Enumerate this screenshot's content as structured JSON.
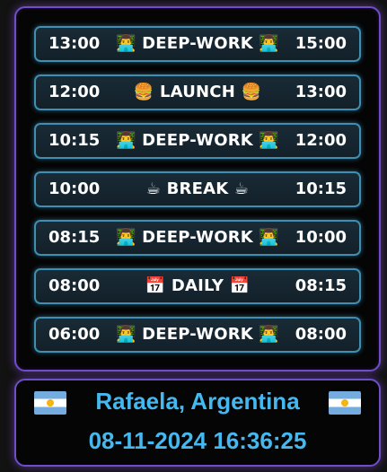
{
  "schedule": [
    {
      "start": "13:00",
      "activity": "DEEP-WORK",
      "icon": "👨‍💻",
      "end": "15:00"
    },
    {
      "start": "12:00",
      "activity": "LAUNCH",
      "icon": "🍔",
      "end": "13:00"
    },
    {
      "start": "10:15",
      "activity": "DEEP-WORK",
      "icon": "👨‍💻",
      "end": "12:00"
    },
    {
      "start": "10:00",
      "activity": "BREAK",
      "icon": "☕",
      "end": "10:15"
    },
    {
      "start": "08:15",
      "activity": "DEEP-WORK",
      "icon": "👨‍💻",
      "end": "10:00"
    },
    {
      "start": "08:00",
      "activity": "DAILY",
      "icon": "📅",
      "end": "08:15"
    },
    {
      "start": "06:00",
      "activity": "DEEP-WORK",
      "icon": "👨‍💻",
      "end": "08:00"
    }
  ],
  "location": {
    "name": "Rafaela, Argentina",
    "datetime": "08-11-2024 16:36:25",
    "flag_icon": "argentina-flag-icon"
  },
  "colors": {
    "accent_purple": "#6e4fc9",
    "slot_border": "#3f8fb3",
    "location_text": "#45b8f0"
  }
}
